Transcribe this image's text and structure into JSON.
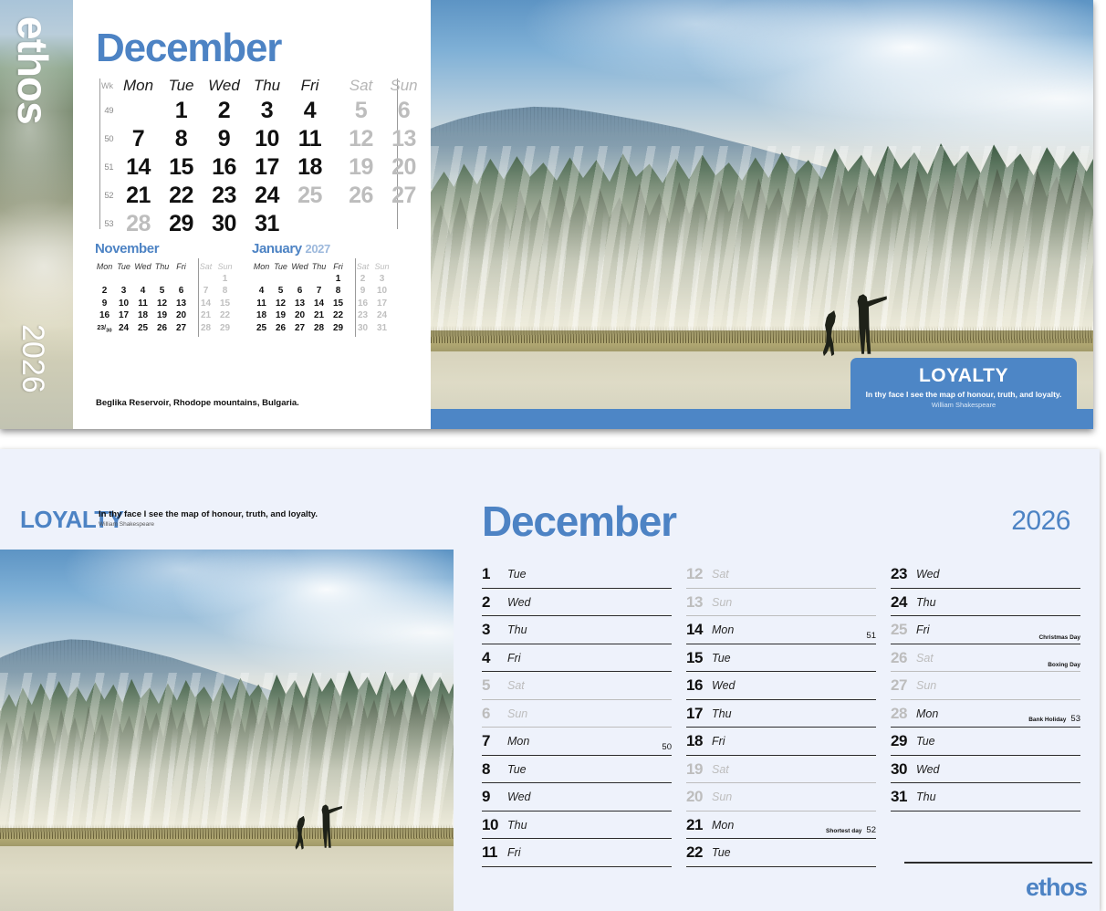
{
  "brand": "ethos",
  "year_spine": "2026",
  "colors": {
    "accent_blue": "#4d83c4",
    "band_blue": "#4d86c6",
    "panel_bg": "#eef2fb",
    "muted": "#bdbdbd"
  },
  "top_panel": {
    "month_title": "December",
    "week_col_header": "Wk",
    "weekday_headers": [
      "Mon",
      "Tue",
      "Wed",
      "Thu",
      "Fri",
      "Sat",
      "Sun"
    ],
    "week_numbers": [
      "49",
      "50",
      "51",
      "52",
      "53"
    ],
    "weeks": [
      [
        "",
        "1",
        "2",
        "3",
        "4",
        "5",
        "6"
      ],
      [
        "7",
        "8",
        "9",
        "10",
        "11",
        "12",
        "13"
      ],
      [
        "14",
        "15",
        "16",
        "17",
        "18",
        "19",
        "20"
      ],
      [
        "21",
        "22",
        "23",
        "24",
        "25",
        "26",
        "27"
      ],
      [
        "28",
        "29",
        "30",
        "31",
        "",
        "",
        ""
      ]
    ],
    "caption": "Beglika Reservoir, Rhodope mountains, Bulgaria.",
    "mini_prev": {
      "title": "November",
      "year": "",
      "headers": [
        "Mon",
        "Tue",
        "Wed",
        "Thu",
        "Fri",
        "Sat",
        "Sun"
      ],
      "weeks": [
        [
          "",
          "",
          "",
          "",
          "",
          "",
          "1"
        ],
        [
          "2",
          "3",
          "4",
          "5",
          "6",
          "7",
          "8"
        ],
        [
          "9",
          "10",
          "11",
          "12",
          "13",
          "14",
          "15"
        ],
        [
          "16",
          "17",
          "18",
          "19",
          "20",
          "21",
          "22"
        ],
        [
          "23/30",
          "24",
          "25",
          "26",
          "27",
          "28",
          "29"
        ]
      ]
    },
    "mini_next": {
      "title": "January",
      "year": "2027",
      "headers": [
        "Mon",
        "Tue",
        "Wed",
        "Thu",
        "Fri",
        "Sat",
        "Sun"
      ],
      "weeks": [
        [
          "",
          "",
          "",
          "",
          "1",
          "2",
          "3"
        ],
        [
          "4",
          "5",
          "6",
          "7",
          "8",
          "9",
          "10"
        ],
        [
          "11",
          "12",
          "13",
          "14",
          "15",
          "16",
          "17"
        ],
        [
          "18",
          "19",
          "20",
          "21",
          "22",
          "23",
          "24"
        ],
        [
          "25",
          "26",
          "27",
          "28",
          "29",
          "30",
          "31"
        ]
      ]
    },
    "quote": {
      "title": "LOYALTY",
      "text": "In thy face I see the map of honour, truth, and loyalty.",
      "author": "William Shakespeare"
    }
  },
  "bottom_panel": {
    "loyalty_title": "LOYALTY",
    "quote_text": "In thy face I see the map of honour, truth, and loyalty.",
    "quote_author": "William Shakespeare",
    "month_title": "December",
    "year": "2026",
    "brand": "ethos",
    "columns": [
      [
        {
          "num": "1",
          "day": "Tue",
          "weekend": false,
          "note": "",
          "wk": ""
        },
        {
          "num": "2",
          "day": "Wed",
          "weekend": false,
          "note": "",
          "wk": ""
        },
        {
          "num": "3",
          "day": "Thu",
          "weekend": false,
          "note": "",
          "wk": ""
        },
        {
          "num": "4",
          "day": "Fri",
          "weekend": false,
          "note": "",
          "wk": ""
        },
        {
          "num": "5",
          "day": "Sat",
          "weekend": true,
          "note": "",
          "wk": ""
        },
        {
          "num": "6",
          "day": "Sun",
          "weekend": true,
          "note": "",
          "wk": ""
        },
        {
          "num": "7",
          "day": "Mon",
          "weekend": false,
          "note": "",
          "wk": "50"
        },
        {
          "num": "8",
          "day": "Tue",
          "weekend": false,
          "note": "",
          "wk": ""
        },
        {
          "num": "9",
          "day": "Wed",
          "weekend": false,
          "note": "",
          "wk": ""
        },
        {
          "num": "10",
          "day": "Thu",
          "weekend": false,
          "note": "",
          "wk": ""
        },
        {
          "num": "11",
          "day": "Fri",
          "weekend": false,
          "note": "",
          "wk": ""
        }
      ],
      [
        {
          "num": "12",
          "day": "Sat",
          "weekend": true,
          "note": "",
          "wk": ""
        },
        {
          "num": "13",
          "day": "Sun",
          "weekend": true,
          "note": "",
          "wk": ""
        },
        {
          "num": "14",
          "day": "Mon",
          "weekend": false,
          "note": "",
          "wk": "51"
        },
        {
          "num": "15",
          "day": "Tue",
          "weekend": false,
          "note": "",
          "wk": ""
        },
        {
          "num": "16",
          "day": "Wed",
          "weekend": false,
          "note": "",
          "wk": ""
        },
        {
          "num": "17",
          "day": "Thu",
          "weekend": false,
          "note": "",
          "wk": ""
        },
        {
          "num": "18",
          "day": "Fri",
          "weekend": false,
          "note": "",
          "wk": ""
        },
        {
          "num": "19",
          "day": "Sat",
          "weekend": true,
          "note": "",
          "wk": ""
        },
        {
          "num": "20",
          "day": "Sun",
          "weekend": true,
          "note": "",
          "wk": ""
        },
        {
          "num": "21",
          "day": "Mon",
          "weekend": false,
          "note": "Shortest day",
          "wk": "52"
        },
        {
          "num": "22",
          "day": "Tue",
          "weekend": false,
          "note": "",
          "wk": ""
        }
      ],
      [
        {
          "num": "23",
          "day": "Wed",
          "weekend": false,
          "note": "",
          "wk": ""
        },
        {
          "num": "24",
          "day": "Thu",
          "weekend": false,
          "note": "",
          "wk": ""
        },
        {
          "num": "25",
          "day": "Fri",
          "weekend": false,
          "holiday": true,
          "note": "Christmas Day",
          "wk": ""
        },
        {
          "num": "26",
          "day": "Sat",
          "weekend": true,
          "note": "Boxing Day",
          "wk": ""
        },
        {
          "num": "27",
          "day": "Sun",
          "weekend": true,
          "note": "",
          "wk": ""
        },
        {
          "num": "28",
          "day": "Mon",
          "weekend": false,
          "holiday": true,
          "note": "Bank Holiday",
          "wk": "53"
        },
        {
          "num": "29",
          "day": "Tue",
          "weekend": false,
          "note": "",
          "wk": ""
        },
        {
          "num": "30",
          "day": "Wed",
          "weekend": false,
          "note": "",
          "wk": ""
        },
        {
          "num": "31",
          "day": "Thu",
          "weekend": false,
          "note": "",
          "wk": ""
        }
      ]
    ]
  }
}
